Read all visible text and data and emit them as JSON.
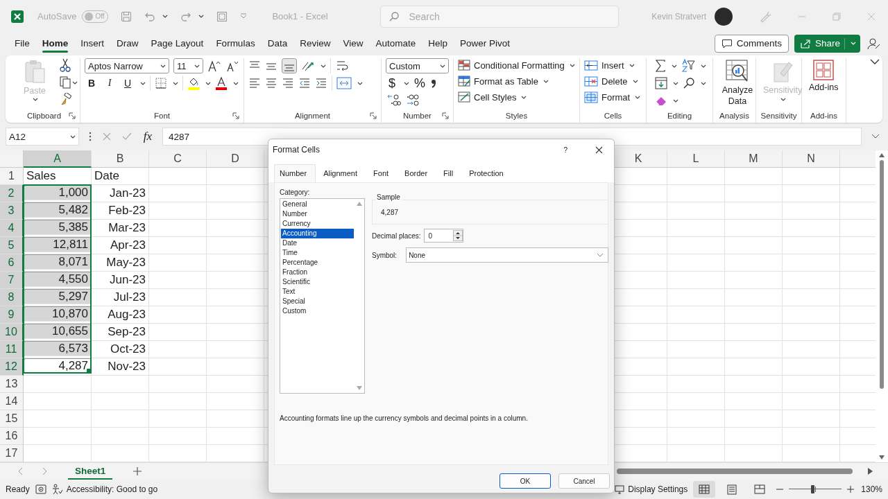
{
  "title_bar": {
    "autosave_label": "AutoSave",
    "autosave": {
      "label": "Off",
      "on": false
    },
    "document_title": "Book1 - Excel",
    "search": {
      "placeholder": "Search"
    },
    "user_name": "Kevin Stratvert"
  },
  "ribbon_tabs": [
    {
      "label": "File",
      "selected": false
    },
    {
      "label": "Home",
      "selected": true
    },
    {
      "label": "Insert",
      "selected": false
    },
    {
      "label": "Draw",
      "selected": false
    },
    {
      "label": "Page Layout",
      "selected": false
    },
    {
      "label": "Formulas",
      "selected": false
    },
    {
      "label": "Data",
      "selected": false
    },
    {
      "label": "Review",
      "selected": false
    },
    {
      "label": "View",
      "selected": false
    },
    {
      "label": "Automate",
      "selected": false
    },
    {
      "label": "Help",
      "selected": false
    },
    {
      "label": "Power Pivot",
      "selected": false
    }
  ],
  "comments_button": "Comments",
  "share_button": "Share",
  "ribbon_groups": [
    {
      "kind": "clipboard",
      "label": "Clipboard",
      "paste": "Paste",
      "paste_disabled": true
    },
    {
      "kind": "font",
      "label": "Font",
      "font_name": "Aptos Narrow",
      "font_size": "11",
      "styles": [
        "B",
        "I",
        "U"
      ]
    },
    {
      "kind": "alignment",
      "label": "Alignment"
    },
    {
      "kind": "number",
      "label": "Number",
      "format": "Custom",
      "symbols": [
        "$",
        "%"
      ]
    },
    {
      "kind": "styles",
      "label": "Styles",
      "commands": [
        "Conditional Formatting",
        "Format as Table",
        "Cell Styles"
      ]
    },
    {
      "kind": "cells",
      "label": "Cells",
      "commands": [
        "Insert",
        "Delete",
        "Format"
      ]
    },
    {
      "kind": "editing",
      "label": "Editing"
    },
    {
      "kind": "analysis",
      "label": "Analysis",
      "command": "Analyze Data"
    },
    {
      "kind": "sensitivity",
      "label": "Sensitivity",
      "command": "Sensitivity",
      "disabled": true
    },
    {
      "kind": "addins",
      "label": "Add-ins",
      "command": "Add-ins"
    }
  ],
  "formula_bar": {
    "name_box": "A12",
    "function_button": "fx",
    "formula": "4287"
  },
  "sheet": {
    "columns": [
      {
        "label": "A",
        "selected": true
      },
      {
        "label": "B",
        "selected": false
      },
      {
        "label": "C",
        "selected": false
      },
      {
        "label": "D",
        "selected": false
      }
    ],
    "columns_right": [
      {
        "label": "K",
        "selected": false
      },
      {
        "label": "L",
        "selected": false
      },
      {
        "label": "M",
        "selected": false
      },
      {
        "label": "N",
        "selected": false
      }
    ],
    "rows": [
      {
        "header": "1",
        "selected": false,
        "cells": [
          {
            "text": "Sales",
            "kind": "text",
            "selected": false,
            "active": false
          },
          {
            "text": "Date",
            "kind": "text",
            "selected": false,
            "active": false
          }
        ]
      },
      {
        "header": "2",
        "selected": true,
        "cells": [
          {
            "text": "1,000",
            "kind": "value",
            "selected": true,
            "active": false
          },
          {
            "text": "Jan-23",
            "kind": "value",
            "selected": false,
            "active": false
          }
        ]
      },
      {
        "header": "3",
        "selected": true,
        "cells": [
          {
            "text": "5,482",
            "kind": "value",
            "selected": true,
            "active": false
          },
          {
            "text": "Feb-23",
            "kind": "value",
            "selected": false,
            "active": false
          }
        ]
      },
      {
        "header": "4",
        "selected": true,
        "cells": [
          {
            "text": "5,385",
            "kind": "value",
            "selected": true,
            "active": false
          },
          {
            "text": "Mar-23",
            "kind": "value",
            "selected": false,
            "active": false
          }
        ]
      },
      {
        "header": "5",
        "selected": true,
        "cells": [
          {
            "text": "12,811",
            "kind": "value",
            "selected": true,
            "active": false
          },
          {
            "text": "Apr-23",
            "kind": "value",
            "selected": false,
            "active": false
          }
        ]
      },
      {
        "header": "6",
        "selected": true,
        "cells": [
          {
            "text": "8,071",
            "kind": "value",
            "selected": true,
            "active": false
          },
          {
            "text": "May-23",
            "kind": "value",
            "selected": false,
            "active": false
          }
        ]
      },
      {
        "header": "7",
        "selected": true,
        "cells": [
          {
            "text": "4,550",
            "kind": "value",
            "selected": true,
            "active": false
          },
          {
            "text": "Jun-23",
            "kind": "value",
            "selected": false,
            "active": false
          }
        ]
      },
      {
        "header": "8",
        "selected": true,
        "cells": [
          {
            "text": "5,297",
            "kind": "value",
            "selected": true,
            "active": false
          },
          {
            "text": "Jul-23",
            "kind": "value",
            "selected": false,
            "active": false
          }
        ]
      },
      {
        "header": "9",
        "selected": true,
        "cells": [
          {
            "text": "10,870",
            "kind": "value",
            "selected": true,
            "active": false
          },
          {
            "text": "Aug-23",
            "kind": "value",
            "selected": false,
            "active": false
          }
        ]
      },
      {
        "header": "10",
        "selected": true,
        "cells": [
          {
            "text": "10,655",
            "kind": "value",
            "selected": true,
            "active": false
          },
          {
            "text": "Sep-23",
            "kind": "value",
            "selected": false,
            "active": false
          }
        ]
      },
      {
        "header": "11",
        "selected": true,
        "cells": [
          {
            "text": "6,573",
            "kind": "value",
            "selected": true,
            "active": false
          },
          {
            "text": "Oct-23",
            "kind": "value",
            "selected": false,
            "active": false
          }
        ]
      },
      {
        "header": "12",
        "selected": true,
        "cells": [
          {
            "text": "4,287",
            "kind": "value",
            "selected": true,
            "active": true
          },
          {
            "text": "Nov-23",
            "kind": "value",
            "selected": false,
            "active": false
          }
        ]
      },
      {
        "header": "13",
        "selected": false,
        "cells": []
      },
      {
        "header": "14",
        "selected": false,
        "cells": []
      },
      {
        "header": "15",
        "selected": false,
        "cells": []
      },
      {
        "header": "16",
        "selected": false,
        "cells": []
      },
      {
        "header": "17",
        "selected": false,
        "cells": []
      }
    ]
  },
  "sheet_tabs": [
    {
      "label": "Sheet1",
      "selected": true
    }
  ],
  "status_bar": {
    "ready": "Ready",
    "accessibility": "Accessibility: Good to go",
    "display_settings": "Display Settings",
    "views": [
      {
        "kind": "normal",
        "selected": true
      },
      {
        "kind": "page_layout",
        "selected": false
      },
      {
        "kind": "page_break",
        "selected": false
      }
    ],
    "zoom": {
      "level": 0.45,
      "label": "130%"
    }
  },
  "dialog": {
    "title": "Format Cells",
    "help": "?",
    "tabs": [
      {
        "label": "Number",
        "selected": true
      },
      {
        "label": "Alignment",
        "selected": false
      },
      {
        "label": "Font",
        "selected": false
      },
      {
        "label": "Border",
        "selected": false
      },
      {
        "label": "Fill",
        "selected": false
      },
      {
        "label": "Protection",
        "selected": false
      }
    ],
    "category_label": "Category:",
    "categories": [
      {
        "label": "General",
        "selected": false
      },
      {
        "label": "Number",
        "selected": false
      },
      {
        "label": "Currency",
        "selected": false
      },
      {
        "label": "Accounting",
        "selected": true
      },
      {
        "label": "Date",
        "selected": false
      },
      {
        "label": "Time",
        "selected": false
      },
      {
        "label": "Percentage",
        "selected": false
      },
      {
        "label": "Fraction",
        "selected": false
      },
      {
        "label": "Scientific",
        "selected": false
      },
      {
        "label": "Text",
        "selected": false
      },
      {
        "label": "Special",
        "selected": false
      },
      {
        "label": "Custom",
        "selected": false
      }
    ],
    "sample_label": "Sample",
    "sample_value": "4,287",
    "decimal_label": "Decimal places:",
    "decimal_value": "0",
    "symbol_label": "Symbol:",
    "symbol_value": "None",
    "description": "Accounting formats line up the currency symbols and decimal points in a column.",
    "buttons": [
      {
        "label": "OK",
        "kind": "default"
      },
      {
        "label": "Cancel",
        "kind": "normal"
      }
    ]
  }
}
